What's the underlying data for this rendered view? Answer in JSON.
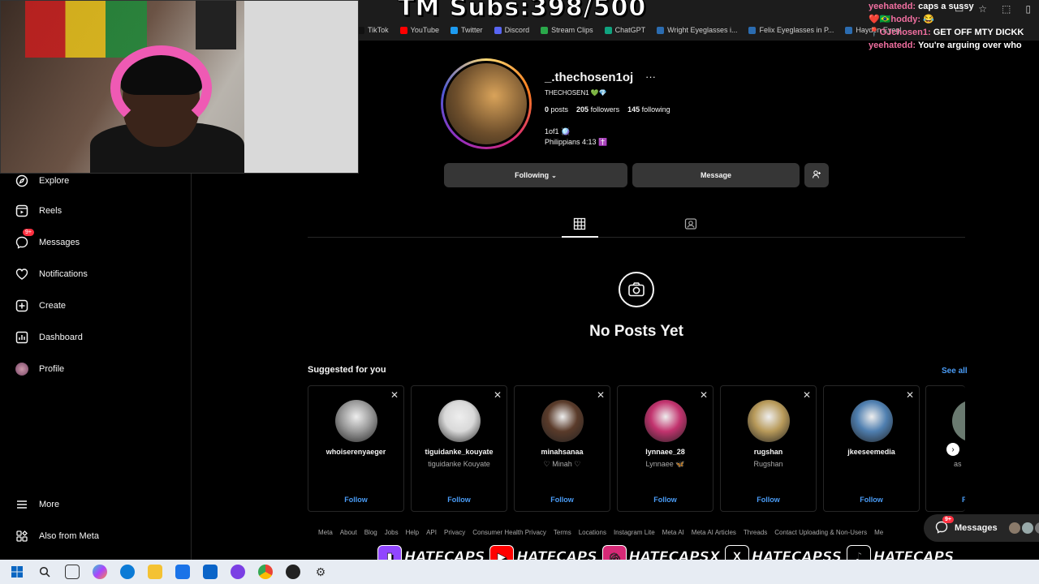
{
  "stream": {
    "subs_counter": "TM Subs:398/500",
    "socials": [
      {
        "platform": "twitch",
        "handle": "HATECAPS",
        "color": "#9146ff",
        "icon": "twitch-icon"
      },
      {
        "platform": "youtube",
        "handle": "HATECAPS",
        "color": "#ff0000",
        "icon": "youtube-icon"
      },
      {
        "platform": "instagram",
        "handle": "HATECAPSX",
        "color": "#d62976",
        "icon": "instagram-icon"
      },
      {
        "platform": "x",
        "handle": "HATECAPSS",
        "color": "#000000",
        "icon": "x-icon"
      },
      {
        "platform": "tiktok",
        "handle": "HATECAPS_",
        "color": "#000000",
        "icon": "tiktok-icon"
      }
    ],
    "chat": [
      {
        "user": "yeehatedd:",
        "msg": "caps a sussy"
      },
      {
        "user": "❤️🇧🇷hoddy:",
        "msg": "😂"
      },
      {
        "user": "📍OJchosen1:",
        "msg": "GET OFF MTY DICKK"
      },
      {
        "user": "yeehatedd:",
        "msg": "You're arguing over who"
      }
    ]
  },
  "bookmarks": [
    "TikTok",
    "YouTube",
    "Twitter",
    "Discord",
    "Stream Clips",
    "ChatGPT",
    "Wright Eyeglasses i...",
    "Felix Eyeglasses in P...",
    "Hayden Eyegl"
  ],
  "bookmark_colors": [
    "#111111",
    "#ff0000",
    "#1d9bf0",
    "#5865f2",
    "#2aa84a",
    "#10a37f",
    "#2b6cb0",
    "#2b6cb0",
    "#2b6cb0"
  ],
  "sidebar": {
    "items": [
      {
        "label": "Explore",
        "icon": "compass-icon"
      },
      {
        "label": "Reels",
        "icon": "reels-icon"
      },
      {
        "label": "Messages",
        "icon": "messenger-icon",
        "badge": "9+"
      },
      {
        "label": "Notifications",
        "icon": "heart-icon"
      },
      {
        "label": "Create",
        "icon": "plus-square-icon"
      },
      {
        "label": "Dashboard",
        "icon": "dashboard-icon"
      },
      {
        "label": "Profile",
        "icon": "avatar"
      }
    ],
    "bottom": [
      {
        "label": "More",
        "icon": "menu-icon"
      },
      {
        "label": "Also from Meta",
        "icon": "meta-grid-icon"
      }
    ]
  },
  "profile": {
    "username": "_.thechosen1oj",
    "full_name": "THECHOSEN1 💚💎",
    "posts": "0",
    "posts_label": "posts",
    "followers": "205",
    "followers_label": "followers",
    "following": "145",
    "following_label": "following",
    "bio_line1": "1of1 🪩",
    "bio_line2": "Philippians 4:13 ✝️",
    "following_button": "Following",
    "message_button": "Message"
  },
  "empty_state": {
    "title": "No Posts Yet"
  },
  "suggestions": {
    "title": "Suggested for you",
    "see_all": "See all",
    "follow_label": "Follow",
    "cards": [
      {
        "username": "whoiserenyaeger",
        "name": "",
        "avatar_color": "#9a9a9a"
      },
      {
        "username": "tiguidanke_kouyate",
        "name": "tiguidanke Kouyate",
        "avatar_color": "#d9d9d9"
      },
      {
        "username": "minahsanaa",
        "name": "♡ Minah ♡",
        "avatar_color": "#5a3b2a"
      },
      {
        "username": "lynnaee_28",
        "name": "Lynnaee 🦋",
        "avatar_color": "#c2336e"
      },
      {
        "username": "rugshan",
        "name": "Rugshan",
        "avatar_color": "#b89a5a"
      },
      {
        "username": "jkeeseemedia",
        "name": "",
        "avatar_color": "#4f7fb0"
      }
    ],
    "partial_card": {
      "username": "a",
      "name": "as",
      "follow": "F"
    }
  },
  "footer_links": [
    "Meta",
    "About",
    "Blog",
    "Jobs",
    "Help",
    "API",
    "Privacy",
    "Consumer Health Privacy",
    "Terms",
    "Locations",
    "Instagram Lite",
    "Meta AI",
    "Meta AI Articles",
    "Threads",
    "Contact Uploading & Non-Users",
    "Me"
  ],
  "messages_pill": {
    "label": "Messages",
    "badge": "9+"
  },
  "colors": {
    "accent": "#4a9cf6",
    "badge": "#ff3040",
    "button_bg": "#363636",
    "background": "#000000"
  }
}
